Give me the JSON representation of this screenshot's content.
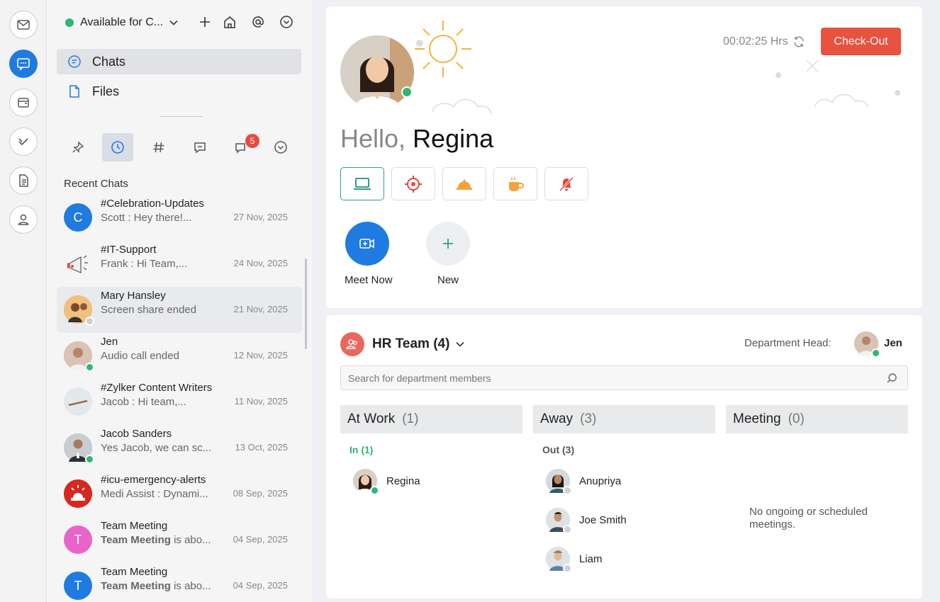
{
  "status": {
    "label": "Available for C..."
  },
  "nav": {
    "chats": "Chats",
    "files": "Files"
  },
  "filters": {
    "unread_badge": "5"
  },
  "recent": {
    "title": "Recent Chats",
    "items": [
      {
        "name": "#Celebration-Updates",
        "msg": "Scott : Hey there!...",
        "date": "27 Nov, 2025",
        "initial": "C",
        "color": "#1f7be0"
      },
      {
        "name": "#IT-Support",
        "msg": "Frank : Hi Team,...",
        "date": "24 Nov, 2025"
      },
      {
        "name": "Mary Hansley",
        "msg": "Screen share ended",
        "date": "21 Nov, 2025"
      },
      {
        "name": "Jen",
        "msg": "Audio call ended",
        "date": "12 Nov, 2025"
      },
      {
        "name": "#Zylker Content Writers",
        "msg": "Jacob : Hi team,...",
        "date": "11 Nov, 2025"
      },
      {
        "name": "Jacob Sanders",
        "msg": "Yes Jacob, we can sc...",
        "date": "13 Oct, 2025"
      },
      {
        "name": "#icu-emergency-alerts",
        "msg": "Medi Assist : Dynami...",
        "date": "08 Sep, 2025",
        "avatar_text": "EMERGENCY"
      },
      {
        "name": "Team Meeting",
        "msg_bold": "Team Meeting",
        "msg": " is abo...",
        "date": "04 Sep, 2025",
        "initial": "T",
        "color": "#e864c8"
      },
      {
        "name": "Team Meeting",
        "msg_bold": "Team Meeting",
        "msg": " is abo...",
        "date": "04 Sep, 2025",
        "initial": "T",
        "color": "#1f7be0"
      }
    ]
  },
  "home": {
    "hello": "Hello,",
    "user": "Regina",
    "timer": "00:02:25 Hrs",
    "checkout": "Check-Out",
    "meet_now": "Meet Now",
    "new": "New"
  },
  "team": {
    "name": "HR Team (4)",
    "dept_head_label": "Department Head:",
    "dept_head": "Jen",
    "search_placeholder": "Search for department members",
    "columns": [
      {
        "title": "At Work",
        "count": "(1)"
      },
      {
        "title": "Away",
        "count": "(3)"
      },
      {
        "title": "Meeting",
        "count": "(0)"
      }
    ],
    "in_label": "In (1)",
    "out_label": "Out (3)",
    "at_work": [
      "Regina"
    ],
    "away": [
      "Anupriya",
      "Joe Smith",
      "Liam"
    ],
    "no_meetings": "No ongoing or scheduled meetings."
  },
  "colors": {
    "accent": "#1f7be0",
    "checkout": "#e8523f",
    "online": "#2eb872",
    "in": "#2eb872"
  }
}
